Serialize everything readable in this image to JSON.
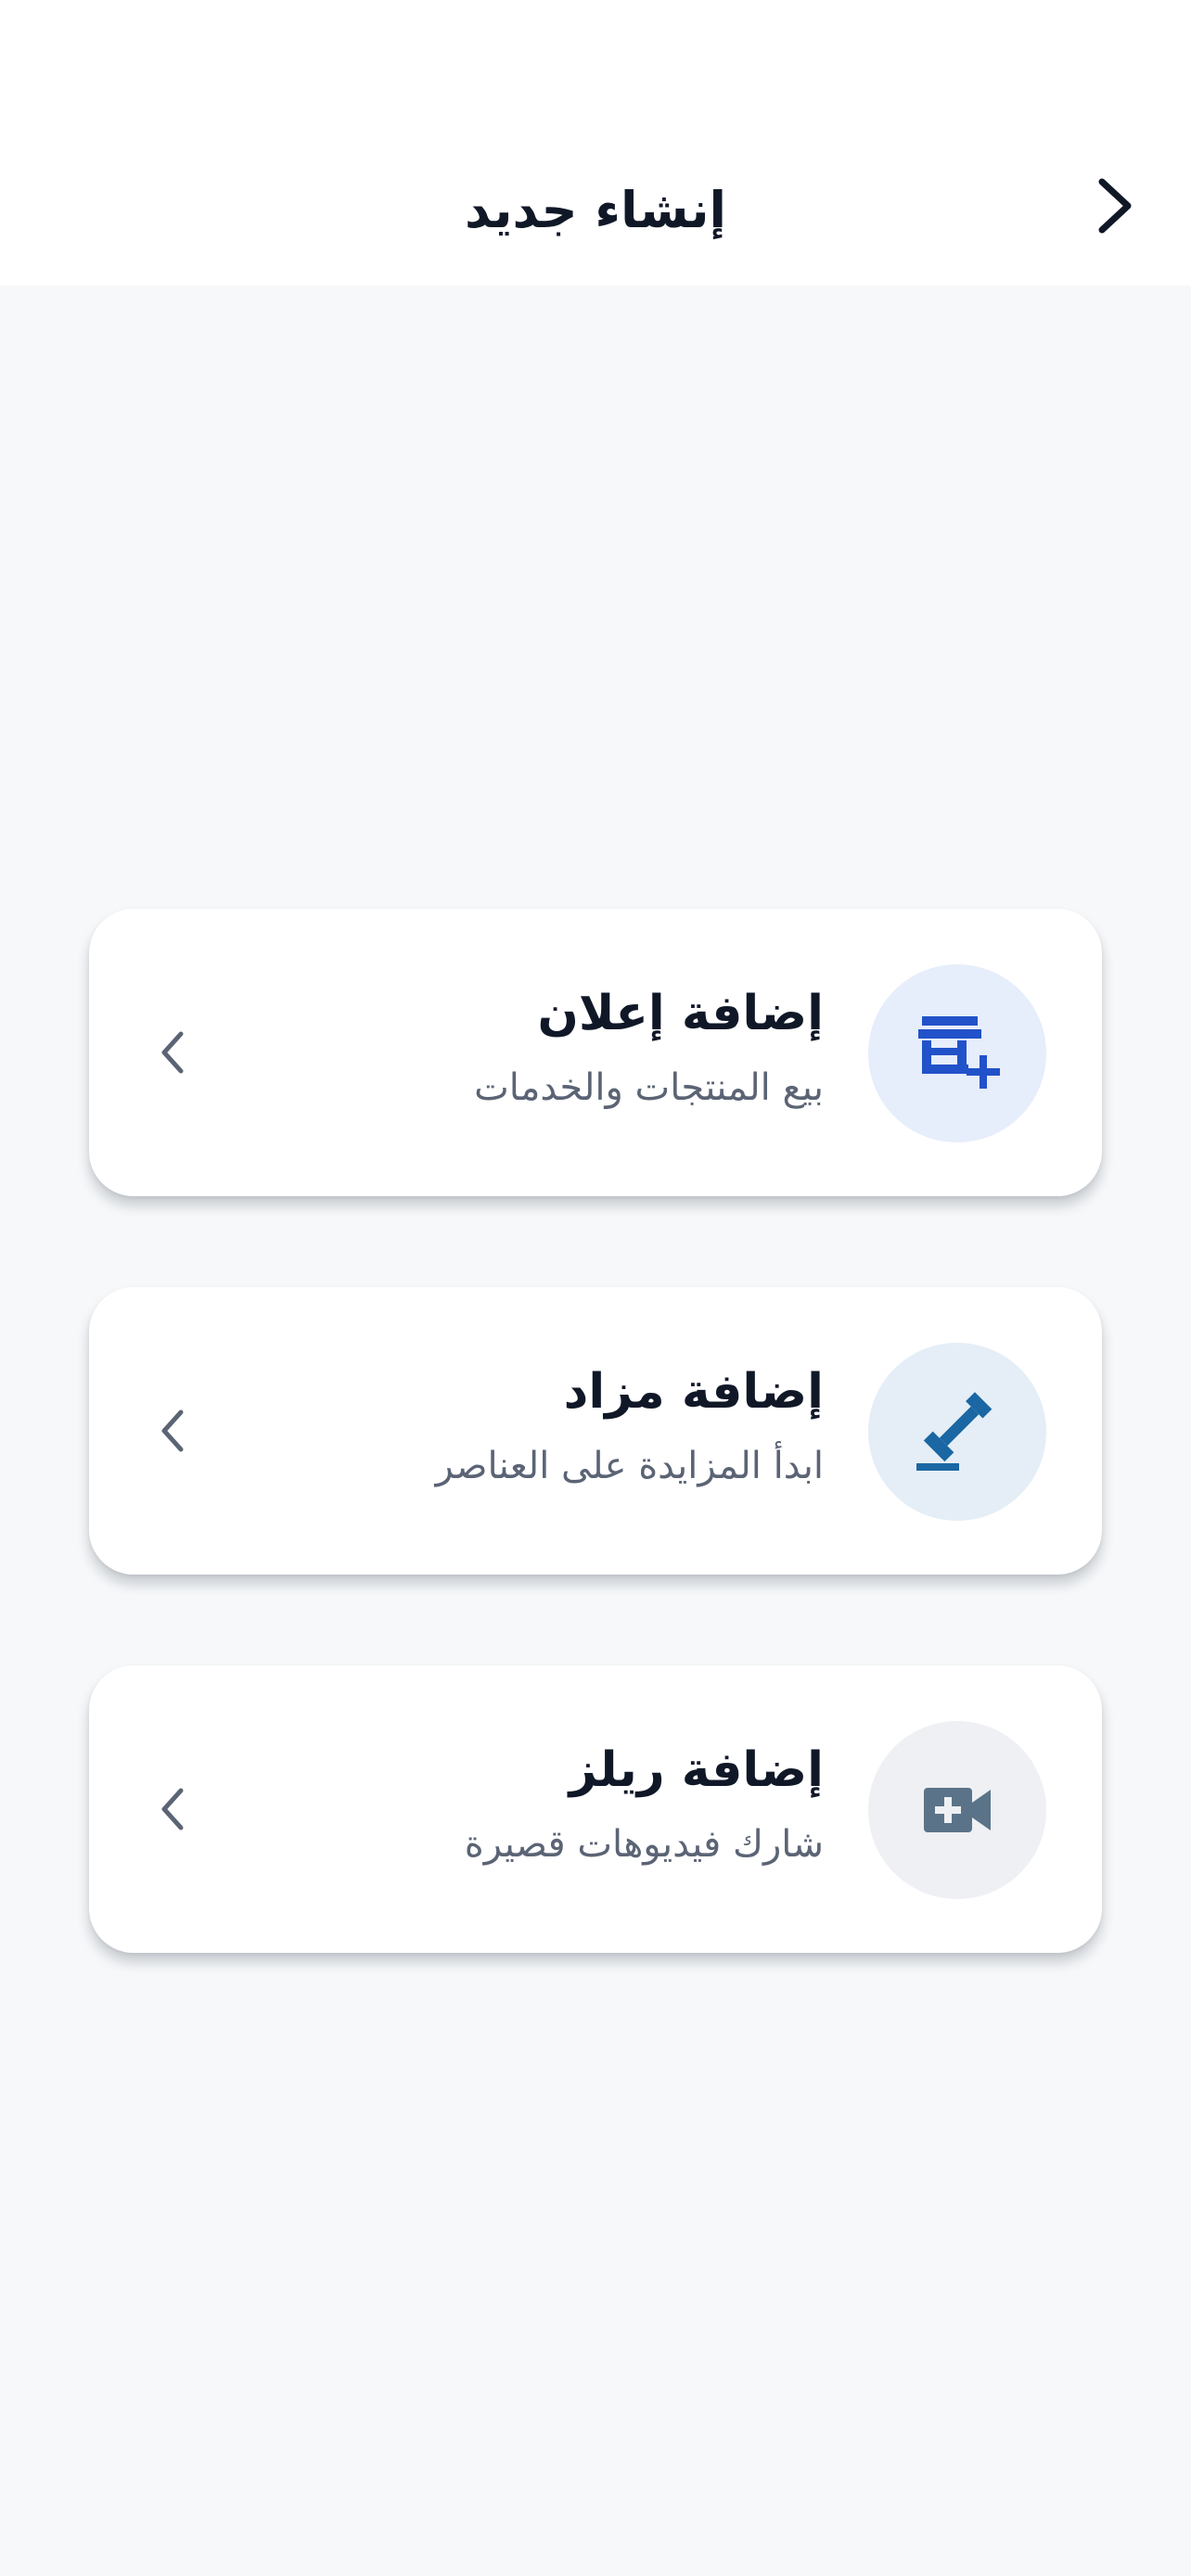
{
  "header": {
    "title": "إنشاء جديد",
    "back_icon": "chevron-right-icon"
  },
  "options": [
    {
      "title": "إضافة إعلان",
      "subtitle": "بيع المنتجات والخدمات",
      "icon": "storefront-add-icon",
      "icon_bg": "#e6edfb",
      "icon_color": "#2252c9"
    },
    {
      "title": "إضافة مزاد",
      "subtitle": "ابدأ المزايدة على العناصر",
      "icon": "gavel-icon",
      "icon_bg": "#e5eef6",
      "icon_color": "#1a67a3"
    },
    {
      "title": "إضافة ريلز",
      "subtitle": "شارك فيديوهات قصيرة",
      "icon": "video-add-icon",
      "icon_bg": "#eef0f3",
      "icon_color": "#5a7388"
    }
  ],
  "colors": {
    "background": "#f6f8fa",
    "card": "#ffffff",
    "title_text": "#101828",
    "subtitle_text": "#5b6475",
    "chevron": "#5b6475"
  }
}
